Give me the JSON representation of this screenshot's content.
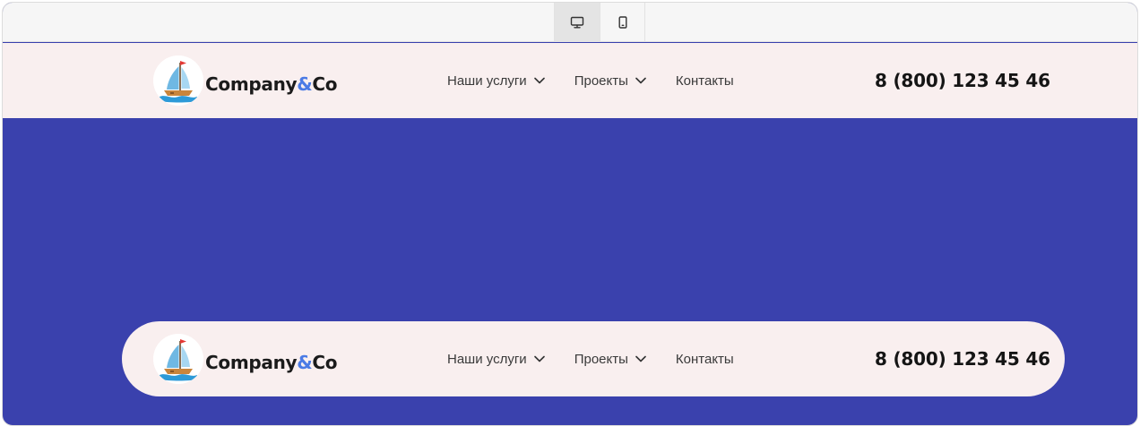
{
  "toolbar": {
    "devices": [
      {
        "icon": "desktop-icon",
        "active": true
      },
      {
        "icon": "mobile-icon",
        "active": false
      }
    ]
  },
  "header": {
    "brand_name": "Company",
    "brand_amp": "&",
    "brand_suffix": "Co",
    "nav": {
      "services": "Наши услуги",
      "projects": "Проекты",
      "contacts": "Контакты"
    },
    "phone": "8 (800) 123 45 46"
  },
  "colors": {
    "background": "#3a41ad",
    "header_bg": "#f9efef",
    "brand_accent": "#4b7be5",
    "toolbar_bg": "#f6f6f6"
  }
}
